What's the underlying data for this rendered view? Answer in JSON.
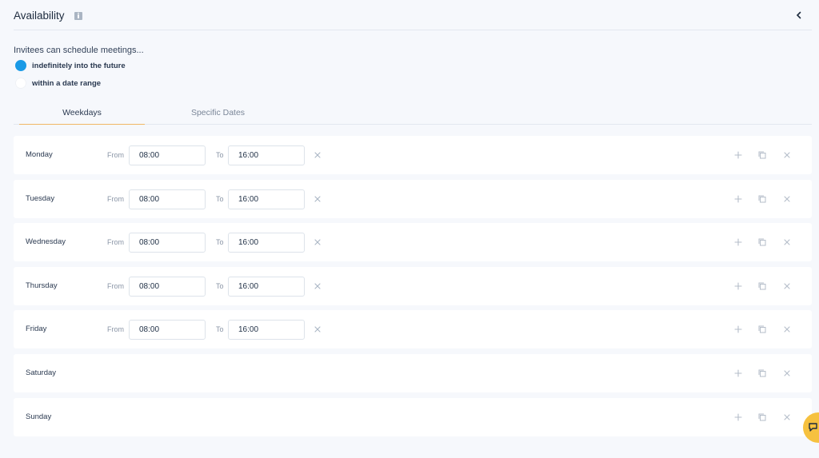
{
  "header": {
    "title": "Availability"
  },
  "schedule": {
    "question": "Invitees can schedule meetings...",
    "options": [
      {
        "label": "indefinitely into the future",
        "selected": true
      },
      {
        "label": "within a date range",
        "selected": false
      }
    ]
  },
  "tabs": [
    {
      "label": "Weekdays",
      "active": true
    },
    {
      "label": "Specific Dates",
      "active": false
    }
  ],
  "labels": {
    "from": "From",
    "to": "To"
  },
  "days": [
    {
      "name": "Monday",
      "from": "08:00",
      "to": "16:00"
    },
    {
      "name": "Tuesday",
      "from": "08:00",
      "to": "16:00"
    },
    {
      "name": "Wednesday",
      "from": "08:00",
      "to": "16:00"
    },
    {
      "name": "Thursday",
      "from": "08:00",
      "to": "16:00"
    },
    {
      "name": "Friday",
      "from": "08:00",
      "to": "16:00"
    },
    {
      "name": "Saturday"
    },
    {
      "name": "Sunday"
    }
  ],
  "icons": {
    "info": "info-icon",
    "collapse": "chevron-left-icon",
    "clear": "close-icon",
    "add": "plus-icon",
    "copy": "copy-icon",
    "delete": "close-icon",
    "chat": "chat-icon"
  },
  "colors": {
    "accent": "#1a9ae6",
    "tab_underline": "#f0b765",
    "chat_button": "#f6c13f",
    "background": "#f6f8fc"
  }
}
